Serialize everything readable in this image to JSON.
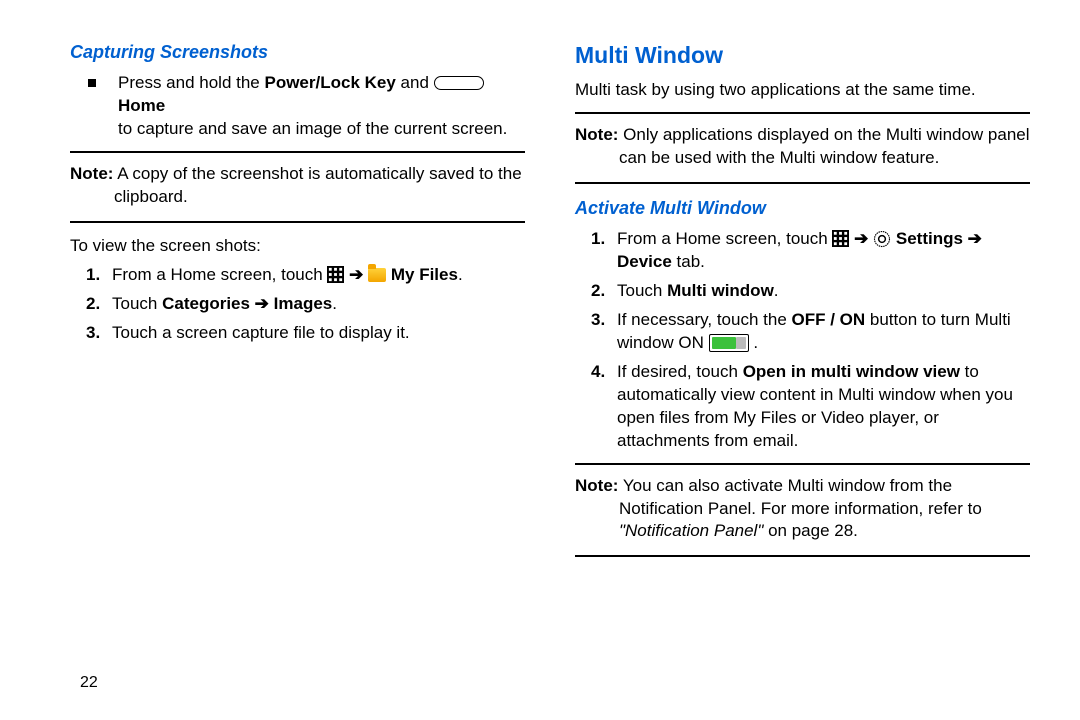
{
  "page_number": "22",
  "left": {
    "subheading": "Capturing Screenshots",
    "bullet": {
      "pre": "Press and hold the ",
      "bold1": "Power/Lock Key",
      "mid1": " and ",
      "bold2": " Home",
      "line2": "to capture and save an image of the current screen."
    },
    "note": {
      "label": "Note:",
      "text": " A copy of the screenshot is automatically saved to the clipboard."
    },
    "intro": "To view the screen shots:",
    "steps": [
      {
        "num": "1.",
        "pre": "From a Home screen, touch ",
        "arrow": "  ➔  ",
        "bold": "My Files",
        "post": "."
      },
      {
        "num": "2.",
        "pre": "Touch ",
        "bold": "Categories ➔ Images",
        "post": "."
      },
      {
        "num": "3.",
        "pre": "Touch a screen capture file to display it."
      }
    ]
  },
  "right": {
    "heading": "Multi Window",
    "intro": "Multi task by using two applications at the same time.",
    "note1": {
      "label": "Note:",
      "text": " Only applications displayed on the Multi window panel can be used with the Multi window feature."
    },
    "subheading": "Activate Multi Window",
    "steps": [
      {
        "num": "1.",
        "pre": "From a Home screen, touch ",
        "arrow1": "  ➔  ",
        "bold1": "Settings ➔",
        "bold2": "Device",
        "post": " tab."
      },
      {
        "num": "2.",
        "pre": "Touch ",
        "bold": "Multi window",
        "post": "."
      },
      {
        "num": "3.",
        "pre": "If necessary, touch the ",
        "bold": "OFF / ON",
        "mid": " button to turn Multi window ON ",
        "post": "."
      },
      {
        "num": "4.",
        "pre": "If desired, touch ",
        "bold": "Open in multi window view",
        "mid": " to automatically view content in Multi window when you open files from My Files or Video player, or attachments from email."
      }
    ],
    "note2": {
      "label": "Note:",
      "text1": " You can also activate Multi window from the Notification Panel. For more information, refer to ",
      "italic": "\"Notification Panel\"",
      "text2": " on page 28."
    }
  }
}
